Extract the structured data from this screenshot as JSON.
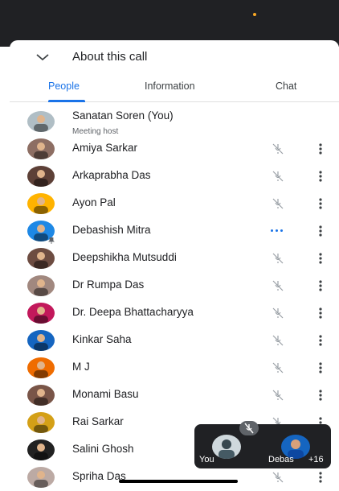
{
  "header": {
    "title": "About this call"
  },
  "tabs": [
    {
      "label": "People",
      "active": true
    },
    {
      "label": "Information",
      "active": false
    },
    {
      "label": "Chat",
      "active": false
    }
  ],
  "participants": [
    {
      "name": "Sanatan Soren (You)",
      "subtitle": "Meeting host",
      "mic": "none"
    },
    {
      "name": "Amiya Sarkar",
      "mic": "muted"
    },
    {
      "name": "Arkaprabha Das",
      "mic": "muted"
    },
    {
      "name": "Ayon Pal",
      "mic": "muted"
    },
    {
      "name": "Debashish Mitra",
      "mic": "speaking",
      "pinned": true
    },
    {
      "name": "Deepshikha Mutsuddi",
      "mic": "muted"
    },
    {
      "name": "Dr Rumpa Das",
      "mic": "muted"
    },
    {
      "name": "Dr. Deepa Bhattacharyya",
      "mic": "muted"
    },
    {
      "name": "Kinkar Saha",
      "mic": "muted"
    },
    {
      "name": "M J",
      "mic": "muted"
    },
    {
      "name": "Monami Basu",
      "mic": "muted"
    },
    {
      "name": "Rai Sarkar",
      "mic": "muted"
    },
    {
      "name": "Salini Ghosh",
      "mic": "muted"
    },
    {
      "name": "Spriha Das",
      "mic": "muted"
    }
  ],
  "floating_tile": {
    "you_label": "You",
    "other_label": "Debas",
    "extra_count": "+16"
  },
  "colors": {
    "accent": "#1a73e8",
    "dark": "#202124",
    "icon": "#5f6368"
  }
}
